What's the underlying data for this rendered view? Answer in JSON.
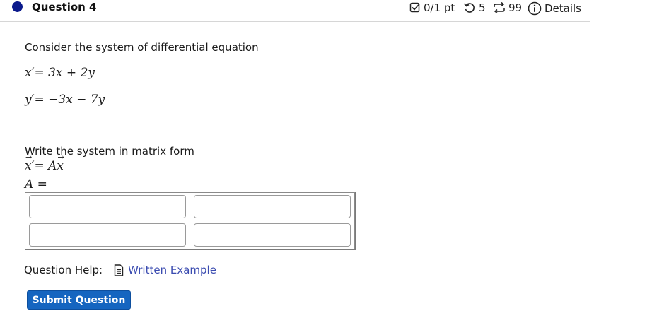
{
  "question": {
    "title": "Question 4",
    "score": "0/1 pt",
    "retries": "5",
    "attempts": "99",
    "details_label": "Details"
  },
  "problem": {
    "intro": "Consider the system of differential equation",
    "eq1_lhs": "x′",
    "eq1_rhs": "3x + 2y",
    "eq2_lhs": "y′",
    "eq2_rhs": "−3x − 7y",
    "matrix_prompt": "Write the system in matrix form",
    "matrix_label": "A ="
  },
  "matrix": {
    "cells": [
      "",
      "",
      "",
      ""
    ]
  },
  "help": {
    "label": "Question Help:",
    "link": "Written Example"
  },
  "submit_label": "Submit Question",
  "colors": {
    "dot": "#0b1a8c",
    "button": "#1565c0",
    "link": "#3a4bb0"
  }
}
